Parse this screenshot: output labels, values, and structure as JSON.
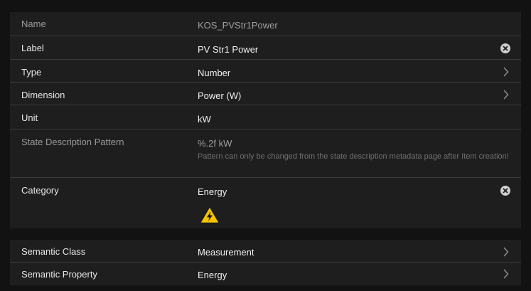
{
  "item_form": {
    "name": {
      "label": "Name",
      "value": "KOS_PVStr1Power"
    },
    "item_label": {
      "label": "Label",
      "value": "PV Str1 Power"
    },
    "type": {
      "label": "Type",
      "value": "Number"
    },
    "dimension": {
      "label": "Dimension",
      "value": "Power (W)"
    },
    "unit": {
      "label": "Unit",
      "value": "kW"
    },
    "state_pattern": {
      "label": "State Description Pattern",
      "value": "%.2f kW",
      "hint": "Pattern can only be changed from the state description metadata page after Item creation!"
    },
    "category": {
      "label": "Category",
      "value": "Energy",
      "icon": "lightning-warning-icon"
    }
  },
  "semantics": {
    "semantic_class": {
      "label": "Semantic Class",
      "value": "Measurement"
    },
    "semantic_property": {
      "label": "Semantic Property",
      "value": "Energy"
    }
  },
  "icons": {
    "clear": "clear-circle-icon",
    "chevron": "chevron-right-icon"
  },
  "colors": {
    "background": "#121212",
    "panel": "#1e1e1e",
    "divider": "#3a3a3a",
    "warning_yellow": "#f5c400"
  }
}
